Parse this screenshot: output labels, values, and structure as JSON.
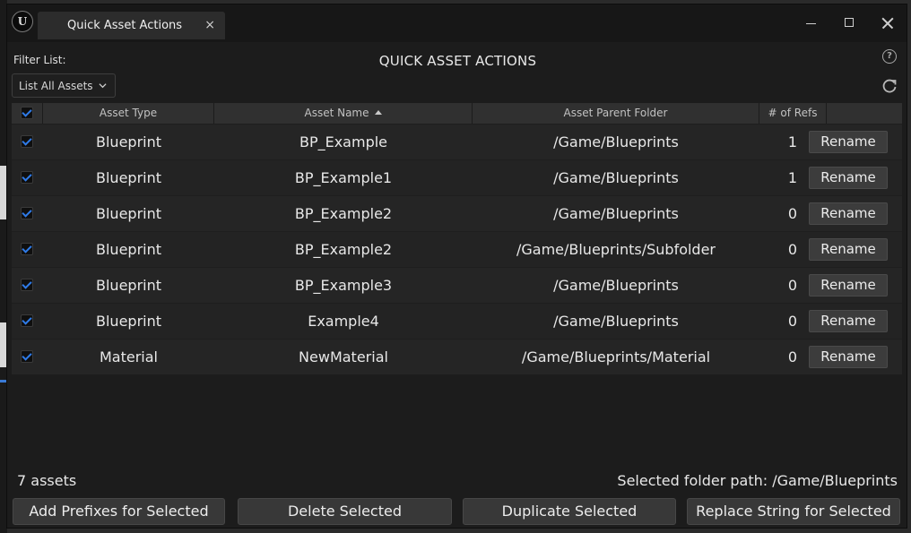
{
  "window": {
    "tab_title": "Quick Asset Actions",
    "close_glyph": "×"
  },
  "header": {
    "filter_label": "Filter List:",
    "dialog_title": "QUICK ASSET ACTIONS",
    "filter_dropdown": "List All Assets",
    "help_glyph": "?"
  },
  "table": {
    "columns": [
      "Asset Type",
      "Asset Name",
      "Asset Parent Folder",
      "# of Refs"
    ],
    "sort_column": "Asset Name",
    "rows": [
      {
        "type": "Blueprint",
        "name": "BP_Example",
        "folder": "/Game/Blueprints",
        "refs": "1",
        "action": "Rename",
        "checked": true
      },
      {
        "type": "Blueprint",
        "name": "BP_Example1",
        "folder": "/Game/Blueprints",
        "refs": "1",
        "action": "Rename",
        "checked": true
      },
      {
        "type": "Blueprint",
        "name": "BP_Example2",
        "folder": "/Game/Blueprints",
        "refs": "0",
        "action": "Rename",
        "checked": true
      },
      {
        "type": "Blueprint",
        "name": "BP_Example2",
        "folder": "/Game/Blueprints/Subfolder",
        "refs": "0",
        "action": "Rename",
        "checked": true
      },
      {
        "type": "Blueprint",
        "name": "BP_Example3",
        "folder": "/Game/Blueprints",
        "refs": "0",
        "action": "Rename",
        "checked": true
      },
      {
        "type": "Blueprint",
        "name": "Example4",
        "folder": "/Game/Blueprints",
        "refs": "0",
        "action": "Rename",
        "checked": true
      },
      {
        "type": "Material",
        "name": "NewMaterial",
        "folder": "/Game/Blueprints/Material",
        "refs": "0",
        "action": "Rename",
        "checked": true
      }
    ]
  },
  "footer": {
    "asset_count": "7 assets",
    "folder_path": "Selected folder path: /Game/Blueprints",
    "buttons": [
      "Add Prefixes for Selected",
      "Delete Selected",
      "Duplicate Selected",
      "Replace String for Selected"
    ]
  },
  "colors": {
    "accent": "#2f7be8",
    "background": "#1c1c1c",
    "button": "#383838"
  }
}
